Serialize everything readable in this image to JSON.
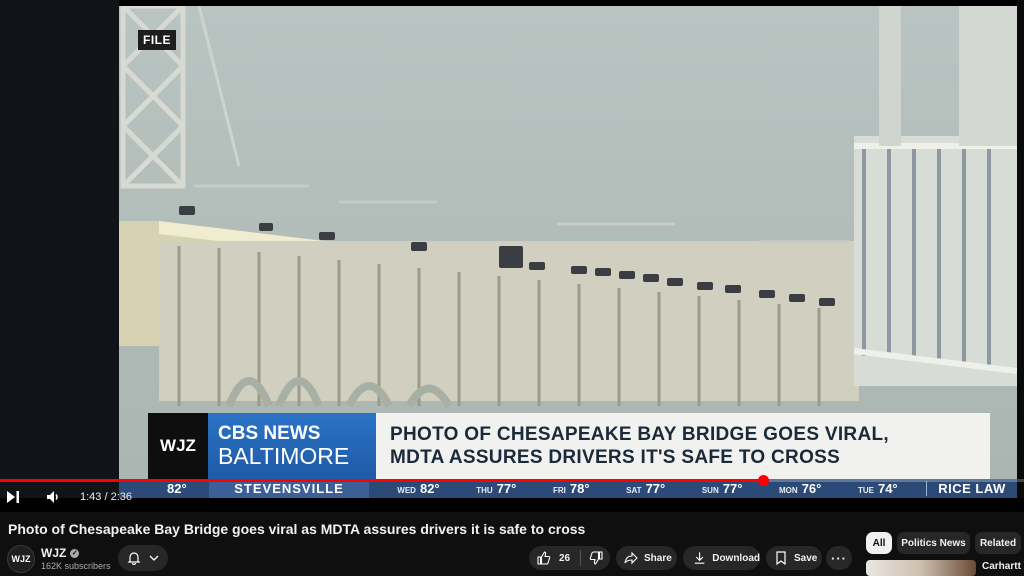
{
  "video": {
    "file_tag": "FILE",
    "lower_third": {
      "station": "WJZ",
      "network_line1": "CBS NEWS",
      "network_line2": "BALTIMORE",
      "headline_line1": "PHOTO OF CHESAPEAKE BAY BRIDGE GOES VIRAL,",
      "headline_line2": "MDTA ASSURES DRIVERS IT'S SAFE TO CROSS"
    },
    "ticker": {
      "current_temp": "82°",
      "city": "STEVENSVILLE",
      "forecast": [
        {
          "day": "WED",
          "temp": "82°"
        },
        {
          "day": "THU",
          "temp": "77°"
        },
        {
          "day": "FRI",
          "temp": "78°"
        },
        {
          "day": "SAT",
          "temp": "77°"
        },
        {
          "day": "SUN",
          "temp": "77°"
        },
        {
          "day": "MON",
          "temp": "76°"
        },
        {
          "day": "TUE",
          "temp": "74°"
        }
      ],
      "sponsor": "RICE LAW"
    },
    "progress_fraction": 0.745
  },
  "controls": {
    "time": "1:43 / 2:36",
    "icons": [
      "next-icon",
      "volume-icon"
    ]
  },
  "title": "Photo of Chesapeake Bay Bridge goes viral as MDTA assures drivers it is safe to cross",
  "channel": {
    "avatar_text": "WJZ",
    "name": "WJZ",
    "subscribers": "162K subscribers"
  },
  "actions": {
    "likes": "26",
    "share": "Share",
    "download": "Download",
    "save": "Save",
    "more": "···"
  },
  "chips": [
    "All",
    "Politics News",
    "Related"
  ],
  "recommendation": {
    "title": "Carhartt S"
  },
  "colors": {
    "accent": "#ff0000",
    "cbs_blue": "#2c73c6",
    "ticker_blue": "#2c4a78",
    "background": "#0f0f0f"
  }
}
